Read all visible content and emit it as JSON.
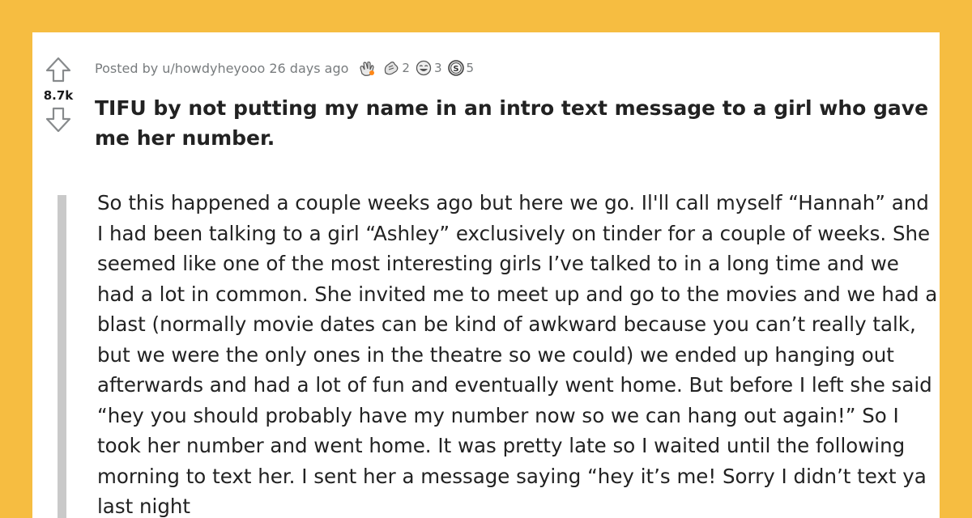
{
  "post": {
    "score": "8.7k",
    "posted_by": "Posted by u/howdyheyooo 26 days ago",
    "awards": [
      {
        "icon": "hands-clap-award-icon",
        "count": ""
      },
      {
        "icon": "helpful-award-icon",
        "count": "2"
      },
      {
        "icon": "laughing-award-icon",
        "count": "3"
      },
      {
        "icon": "silver-award-icon",
        "count": "5"
      }
    ],
    "title": "TIFU by not putting my name in an intro text message to a girl who gave me her number.",
    "body": "So this happened a couple weeks ago but here we go. Il'll call myself “Hannah” and I had been talking to a girl “Ashley” exclusively on tinder for a couple of weeks. She seemed like one of the most interesting girls I’ve talked to in a long time and we had a lot in common. She invited me to meet up and go to the movies and we had a blast (normally movie dates can be kind of awkward because you can’t really talk, but we were the only ones in the theatre so we could) we ended up hanging out afterwards and had a lot of fun and eventually went home. But before I left she said “hey you should probably have my number now so we can hang out again!” So I took her number and went home. It was pretty late so I waited until the following morning to text her. I sent her a message saying “hey it’s me! Sorry I didn’t text ya last night"
  },
  "colors": {
    "background": "#f6bd41",
    "card": "#ffffff",
    "text": "#222222",
    "meta": "#787c7e",
    "quote_bar": "#c9c9c9"
  }
}
